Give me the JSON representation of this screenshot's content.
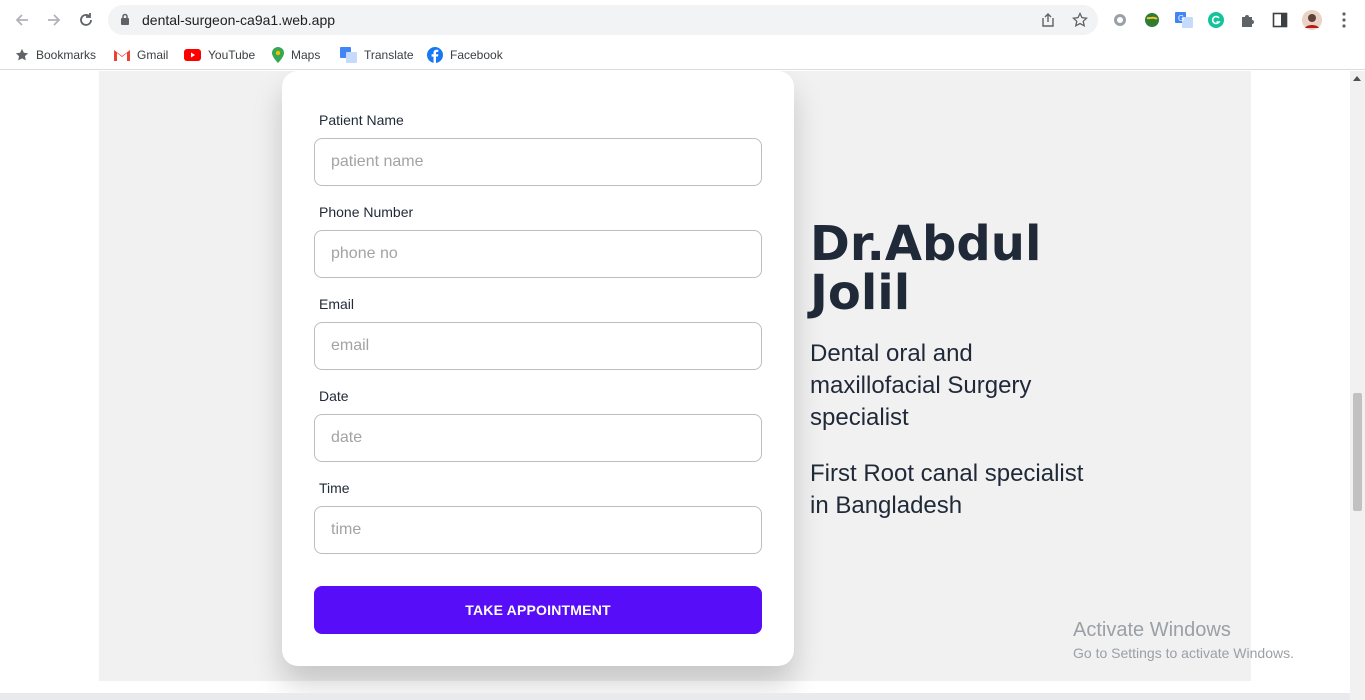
{
  "browser": {
    "url": "dental-surgeon-ca9a1.web.app",
    "bookmarks": [
      {
        "label": "Bookmarks",
        "icon": "star-icon"
      },
      {
        "label": "Gmail",
        "icon": "gmail-icon"
      },
      {
        "label": "YouTube",
        "icon": "youtube-icon"
      },
      {
        "label": "Maps",
        "icon": "maps-icon"
      },
      {
        "label": "Translate",
        "icon": "translate-icon"
      },
      {
        "label": "Facebook",
        "icon": "facebook-icon"
      }
    ]
  },
  "form": {
    "patient_name": {
      "label": "Patient Name",
      "placeholder": "patient name"
    },
    "phone": {
      "label": "Phone Number",
      "placeholder": "phone no"
    },
    "email": {
      "label": "Email",
      "placeholder": "email"
    },
    "date": {
      "label": "Date",
      "placeholder": "date"
    },
    "time": {
      "label": "Time",
      "placeholder": "time"
    },
    "submit_label": "TAKE APPOINTMENT"
  },
  "doctor": {
    "name_line1": "Dr.Abdul",
    "name_line2": "Jolil",
    "specialty": "Dental oral and maxillofacial Surgery specialist",
    "tagline": "First Root canal specialist in Bangladesh"
  },
  "watermark": {
    "title": "Activate Windows",
    "subtitle": "Go to Settings to activate Windows."
  },
  "colors": {
    "primary": "#570df8",
    "hero_background": "#f1f1f1",
    "heading": "#1f2937"
  }
}
